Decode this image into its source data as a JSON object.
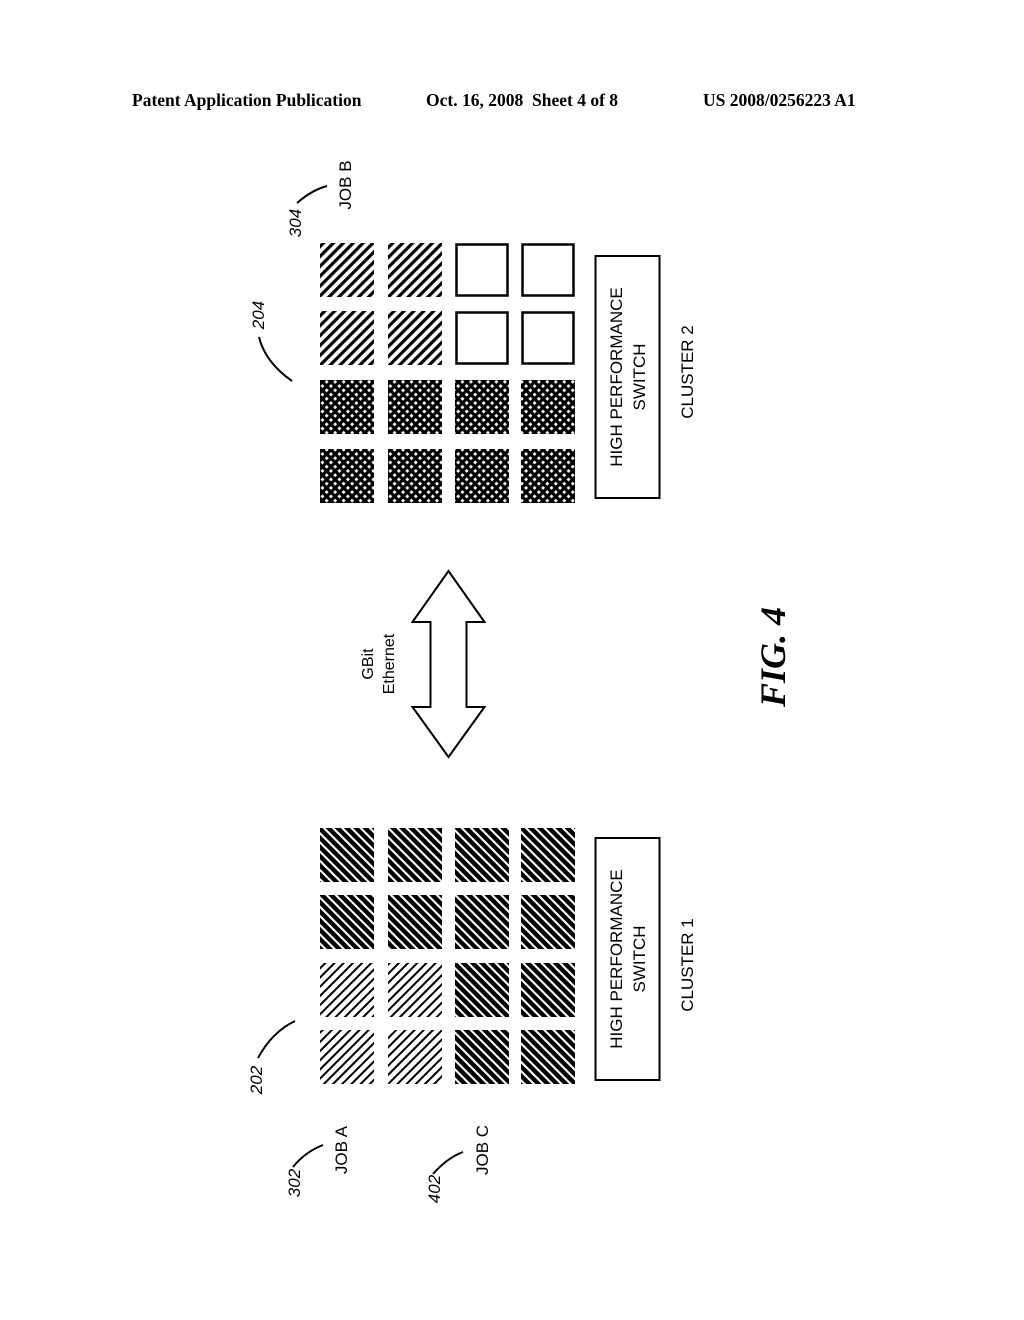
{
  "header": {
    "publication": "Patent Application Publication",
    "date": "Oct. 16, 2008",
    "sheet": "Sheet 4 of 8",
    "number": "US 2008/0256223 A1"
  },
  "figure": {
    "label": "FIG. 4",
    "link": {
      "line1": "GBit",
      "line2": "Ethernet"
    },
    "clusters": [
      {
        "name": "CLUSTER 2",
        "ref": "204",
        "switch_line1": "HIGH PERFORMANCE",
        "switch_line2": "SWITCH",
        "jobs": [
          {
            "ref": "304",
            "label": "JOB B"
          }
        ],
        "grid": [
          [
            "job-b",
            "job-b",
            "idle",
            "idle"
          ],
          [
            "job-b",
            "job-b",
            "idle",
            "idle"
          ],
          [
            "cross",
            "cross",
            "cross",
            "cross"
          ],
          [
            "cross",
            "cross",
            "cross",
            "cross"
          ]
        ]
      },
      {
        "name": "CLUSTER 1",
        "ref": "202",
        "switch_line1": "HIGH PERFORMANCE",
        "switch_line2": "SWITCH",
        "jobs": [
          {
            "ref": "302",
            "label": "JOB A"
          },
          {
            "ref": "402",
            "label": "JOB C"
          }
        ],
        "grid": [
          [
            "dark",
            "dark",
            "dark",
            "dark"
          ],
          [
            "dark",
            "dark",
            "dark",
            "dark"
          ],
          [
            "job-a",
            "job-a",
            "dark",
            "dark"
          ],
          [
            "job-a",
            "job-a",
            "dark",
            "dark"
          ]
        ]
      }
    ]
  }
}
